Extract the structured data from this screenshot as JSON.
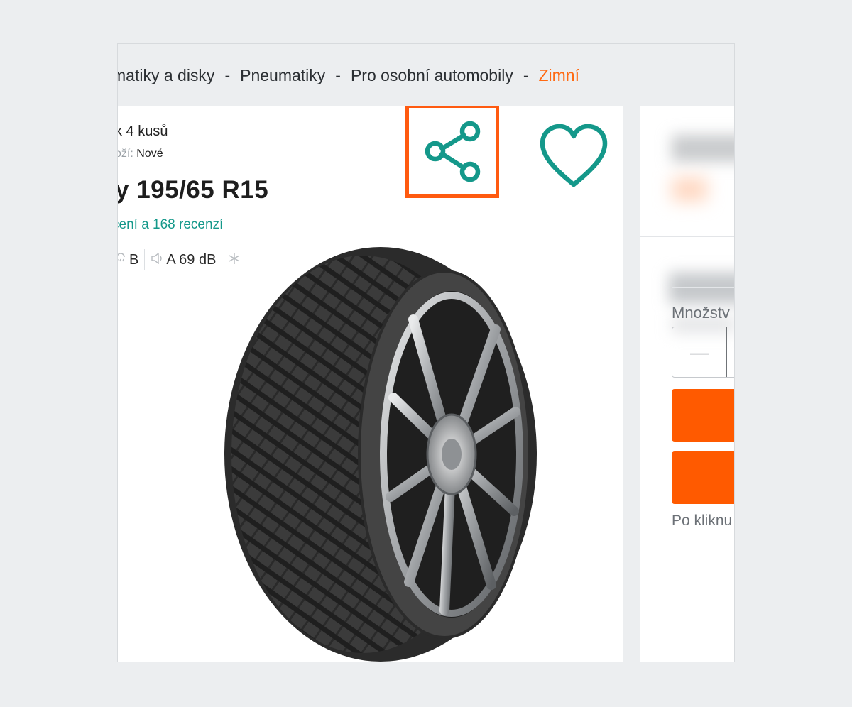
{
  "breadcrumb": {
    "items": [
      "matiky a disky",
      "Pneumatiky",
      "Pro osobní automobily"
    ],
    "current": "Zimní",
    "separator": "-"
  },
  "product": {
    "line1": "k 4 kusů",
    "state_label": "oží:",
    "state_value": "Nové",
    "title": "y 195/65 R15",
    "reviews": "cení a 168 recenzí",
    "specs": {
      "wet_grip": "B",
      "noise": "A 69 dB"
    }
  },
  "sidebar": {
    "quantity_label": "Množstv",
    "quantity_minus": "—",
    "bottom_text": "Po kliknu"
  },
  "colors": {
    "accent": "#ff6a13",
    "teal": "#14988a",
    "button": "#ff5a00",
    "highlight_border": "#ff5a10"
  },
  "icons": {
    "share": "share-icon",
    "favorite": "heart-icon"
  }
}
